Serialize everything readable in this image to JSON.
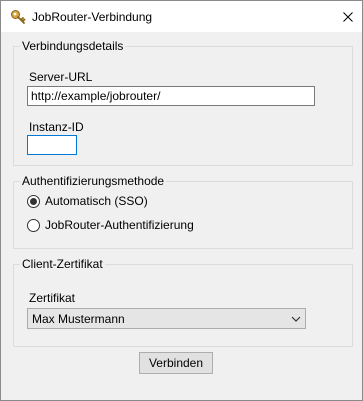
{
  "window": {
    "title": "JobRouter-Verbindung",
    "app_icon": "key-icon",
    "close_icon": "close-icon"
  },
  "connection": {
    "group_label": "Verbindungsdetails",
    "server_url_label": "Server-URL",
    "server_url_value": "http://example/jobrouter/",
    "instance_id_label": "Instanz-ID",
    "instance_id_value": ""
  },
  "auth": {
    "group_label": "Authentifizierungsmethode",
    "options": [
      {
        "label": "Automatisch (SSO)",
        "selected": true
      },
      {
        "label": "JobRouter-Authentifizierung",
        "selected": false
      }
    ]
  },
  "certificate": {
    "group_label": "Client-Zertifikat",
    "field_label": "Zertifikat",
    "selected_value": "Max Mustermann",
    "dropdown_icon": "chevron-down-icon"
  },
  "actions": {
    "connect_label": "Verbinden"
  },
  "colors": {
    "focus_border": "#0078d7",
    "window_background": "#f0f0f0"
  }
}
